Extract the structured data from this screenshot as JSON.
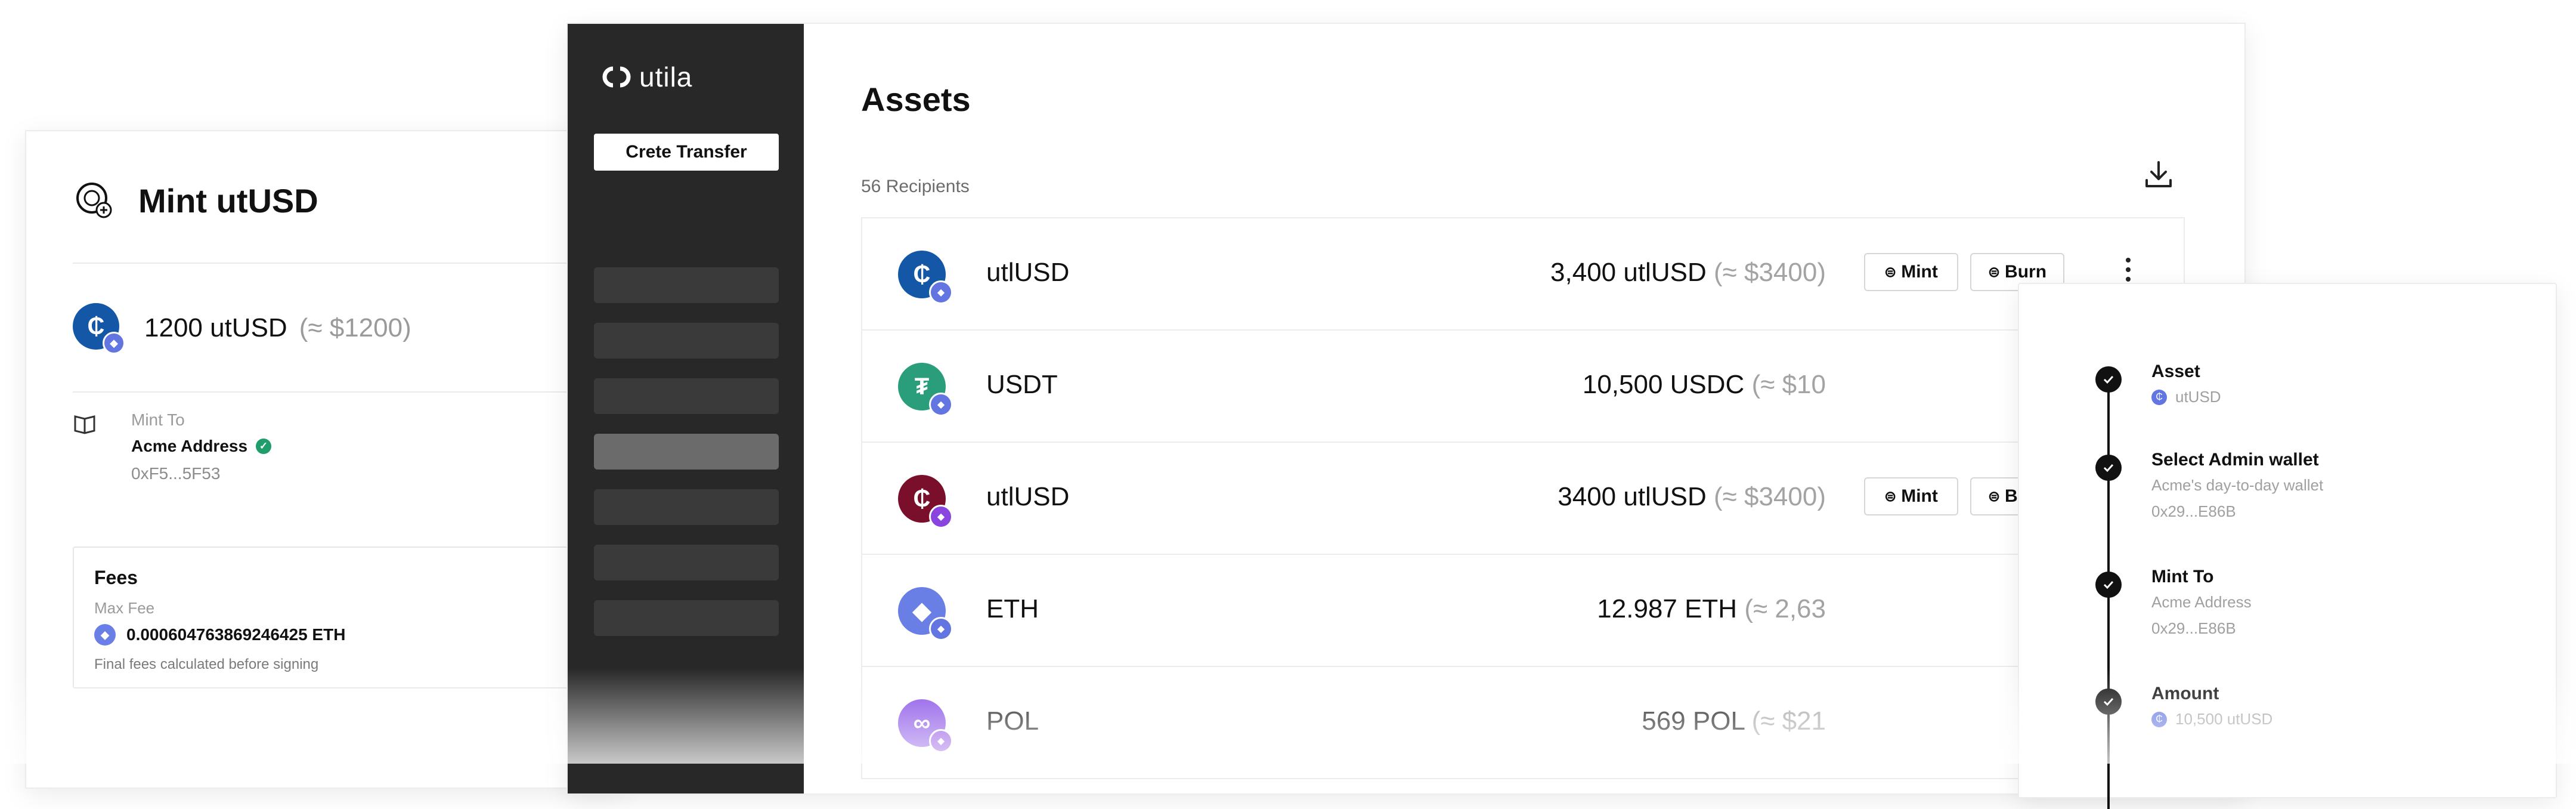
{
  "mint": {
    "title": "Mint utUSD",
    "amount": "1200 utUSD",
    "amount_usd": "(≈ $1200)",
    "mint_to_label": "Mint To",
    "mint_to_name": "Acme Address",
    "mint_to_address": "0xF5...5F53",
    "fees_title": "Fees",
    "max_fee_label": "Max Fee",
    "max_fee_value": "0.000604763869246425 ETH",
    "fees_note": "Final fees calculated before signing"
  },
  "sidebar": {
    "logo_text": "utila",
    "create_button": "Crete Transfer",
    "nav_count": 7,
    "active_index": 3
  },
  "assets": {
    "title": "Assets",
    "recipients": "56 Recipients",
    "rows": [
      {
        "name": "utlUSD",
        "amount": "3,400 utlUSD",
        "usd": "(≈ $3400)",
        "icon": "utlusd-icon",
        "color": "#1357a6",
        "badge": "#6275e0",
        "symbol": "₵",
        "has_actions": true
      },
      {
        "name": "USDT",
        "amount": "10,500 USDC",
        "usd": "(≈ $10",
        "icon": "usdt-icon",
        "color": "#2a9e7a",
        "badge": "#6275e0",
        "symbol": "₮",
        "has_actions": false
      },
      {
        "name": "utlUSD",
        "amount": "3400 utlUSD",
        "usd": "(≈ $3400)",
        "icon": "utlusd-icon",
        "color": "#7a0f2b",
        "badge": "#8a45e0",
        "symbol": "₵",
        "has_actions": true
      },
      {
        "name": "ETH",
        "amount": "12.987 ETH",
        "usd": "(≈ 2,63",
        "icon": "eth-icon",
        "color": "#6a7fe6",
        "badge": "#6275e0",
        "symbol": "◆",
        "has_actions": false
      },
      {
        "name": "POL",
        "amount": "569 POL",
        "usd": "(≈ $21",
        "icon": "pol-icon",
        "color": "#8247e5",
        "badge": "#8a45e0",
        "symbol": "∞",
        "has_actions": false
      }
    ],
    "mint_label": "Mint",
    "burn_label": "Burn"
  },
  "steps": [
    {
      "title": "Asset",
      "sub1": "utUSD",
      "sub2": ""
    },
    {
      "title": "Select Admin wallet",
      "sub1": "Acme's day-to-day wallet",
      "sub2": "0x29...E86B"
    },
    {
      "title": "Mint To",
      "sub1": "Acme Address",
      "sub2": "0x29...E86B"
    },
    {
      "title": "Amount",
      "sub1": "10,500 utUSD",
      "sub2": ""
    }
  ]
}
